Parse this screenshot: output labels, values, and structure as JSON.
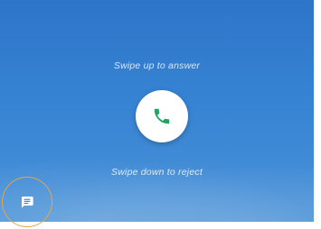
{
  "incoming_call": {
    "swipe_up_text": "Swipe up to answer",
    "swipe_down_text": "Swipe down to reject",
    "answer_icon": "phone-icon",
    "reply_icon": "message-icon"
  },
  "colors": {
    "background_top": "#2e75c9",
    "background_bottom": "#5296d8",
    "answer_icon": "#1fa463",
    "reply_ring": "#e8a34a"
  }
}
